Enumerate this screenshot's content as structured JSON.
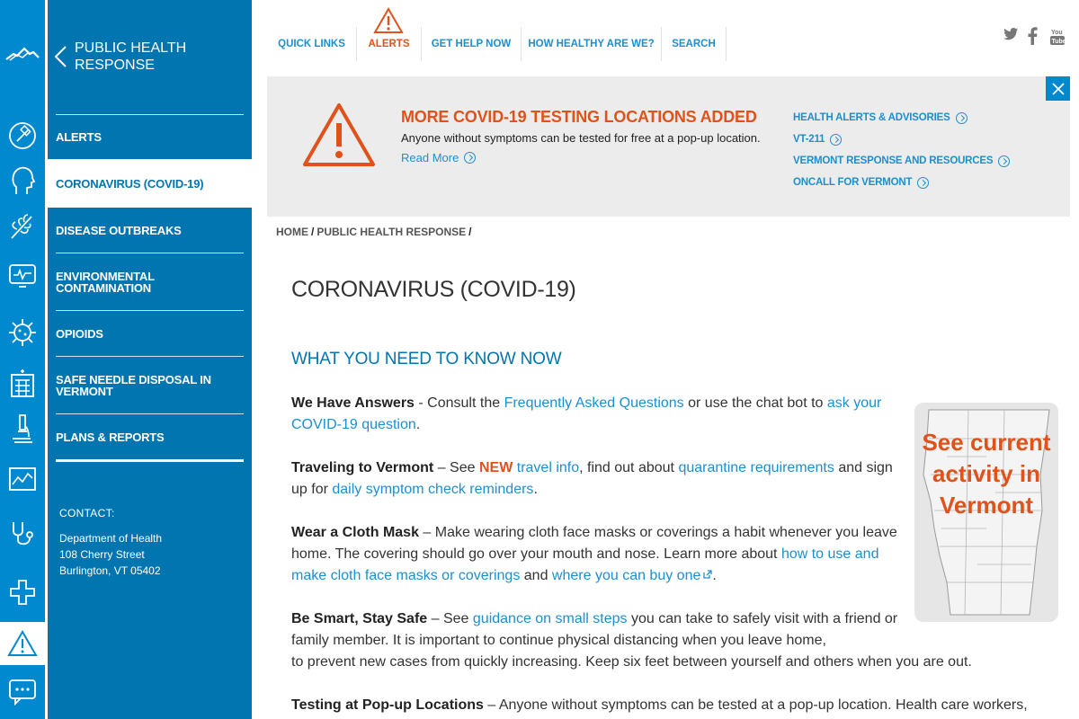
{
  "rail": {
    "icons": [
      "vermont-logo-icon",
      "pill-bottle-icon",
      "head-profile-icon",
      "pollen-icon",
      "heart-monitor-icon",
      "virus-icon",
      "hospital-icon",
      "microscope-icon",
      "chart-icon",
      "stethoscope-icon",
      "medical-cross-icon"
    ],
    "alert_icon": "warning-icon",
    "chat_icon": "chat-icon"
  },
  "sidebar": {
    "title": "PUBLIC HEALTH RESPONSE",
    "items": [
      {
        "label": "ALERTS",
        "active": false
      },
      {
        "label": "CORONAVIRUS (COVID-19)",
        "active": true
      },
      {
        "label": "DISEASE OUTBREAKS",
        "active": false
      },
      {
        "label": "ENVIRONMENTAL CONTAMINATION",
        "active": false
      },
      {
        "label": "OPIOIDS",
        "active": false
      },
      {
        "label": "SAFE NEEDLE DISPOSAL IN VERMONT",
        "active": false
      },
      {
        "label": "PLANS & REPORTS",
        "active": false
      }
    ],
    "contact": {
      "heading": "CONTACT:",
      "line1": "Department of Health",
      "line2": "108 Cherry Street",
      "line3": "Burlington, VT 05402"
    }
  },
  "topnav": {
    "items": [
      "QUICK LINKS",
      "ALERTS",
      "GET HELP NOW",
      "HOW HEALTHY ARE WE?",
      "SEARCH"
    ],
    "social": [
      "twitter-icon",
      "facebook-icon",
      "youtube-icon"
    ]
  },
  "banner": {
    "title": "MORE COVID-19 TESTING LOCATIONS ADDED",
    "description": "Anyone without symptoms can be tested for free at a pop-up location.",
    "read_more": "Read More",
    "links": [
      "HEALTH ALERTS & ADVISORIES",
      "VT-211",
      "VERMONT RESPONSE AND RESOURCES",
      "ONCALL FOR VERMONT"
    ]
  },
  "breadcrumb": {
    "home": "HOME",
    "section": "PUBLIC HEALTH RESPONSE"
  },
  "main": {
    "title": "CORONAVIRUS (COVID-19)",
    "subtitle": "WHAT YOU NEED TO KNOW NOW",
    "p1": {
      "bold": "We Have Answers",
      "t1": " - Consult the ",
      "link1": "Frequently Asked Questions",
      "t2": " or use the chat bot to ",
      "link2": "ask your COVID-19 question",
      "t3": "."
    },
    "p2": {
      "bold": "Traveling to Vermont",
      "t1": " – See ",
      "new": "NEW",
      "link1": "travel info",
      "t2": ", find out about ",
      "link2": "quarantine requirements",
      "t3": " and sign up for ",
      "link3": "daily symptom check reminders",
      "t4": "."
    },
    "p3": {
      "bold": "Wear a Cloth Mask",
      "t1": " – Make wearing cloth face masks or coverings a habit whenever you leave home. The covering should go over your mouth and nose. Learn more about ",
      "link1": "how to use and make cloth face masks or coverings",
      "t2": " and ",
      "link2": "where you can buy one",
      "t3": "."
    },
    "p4": {
      "bold": "Be Smart, Stay Safe",
      "t1": " – See ",
      "link1": "guidance on small steps",
      "t2": " you can take to safely visit with a friend or family member. It is important to continue physical distancing when you leave home,",
      "t3": "to prevent new cases from quickly increasing. Keep six feet between yourself and others when you are out."
    },
    "p5": {
      "bold": "Testing at Pop-up Locations",
      "t1": " – Anyone without symptoms can be tested at a pop-up location. Health care workers,"
    }
  },
  "mapcard": {
    "text": "See current activity in Vermont"
  },
  "colors": {
    "brand_blue": "#0089cf",
    "sidebar_blue": "#0075b0",
    "link_blue": "#1d8fcf",
    "alert_orange": "#e0521a"
  }
}
